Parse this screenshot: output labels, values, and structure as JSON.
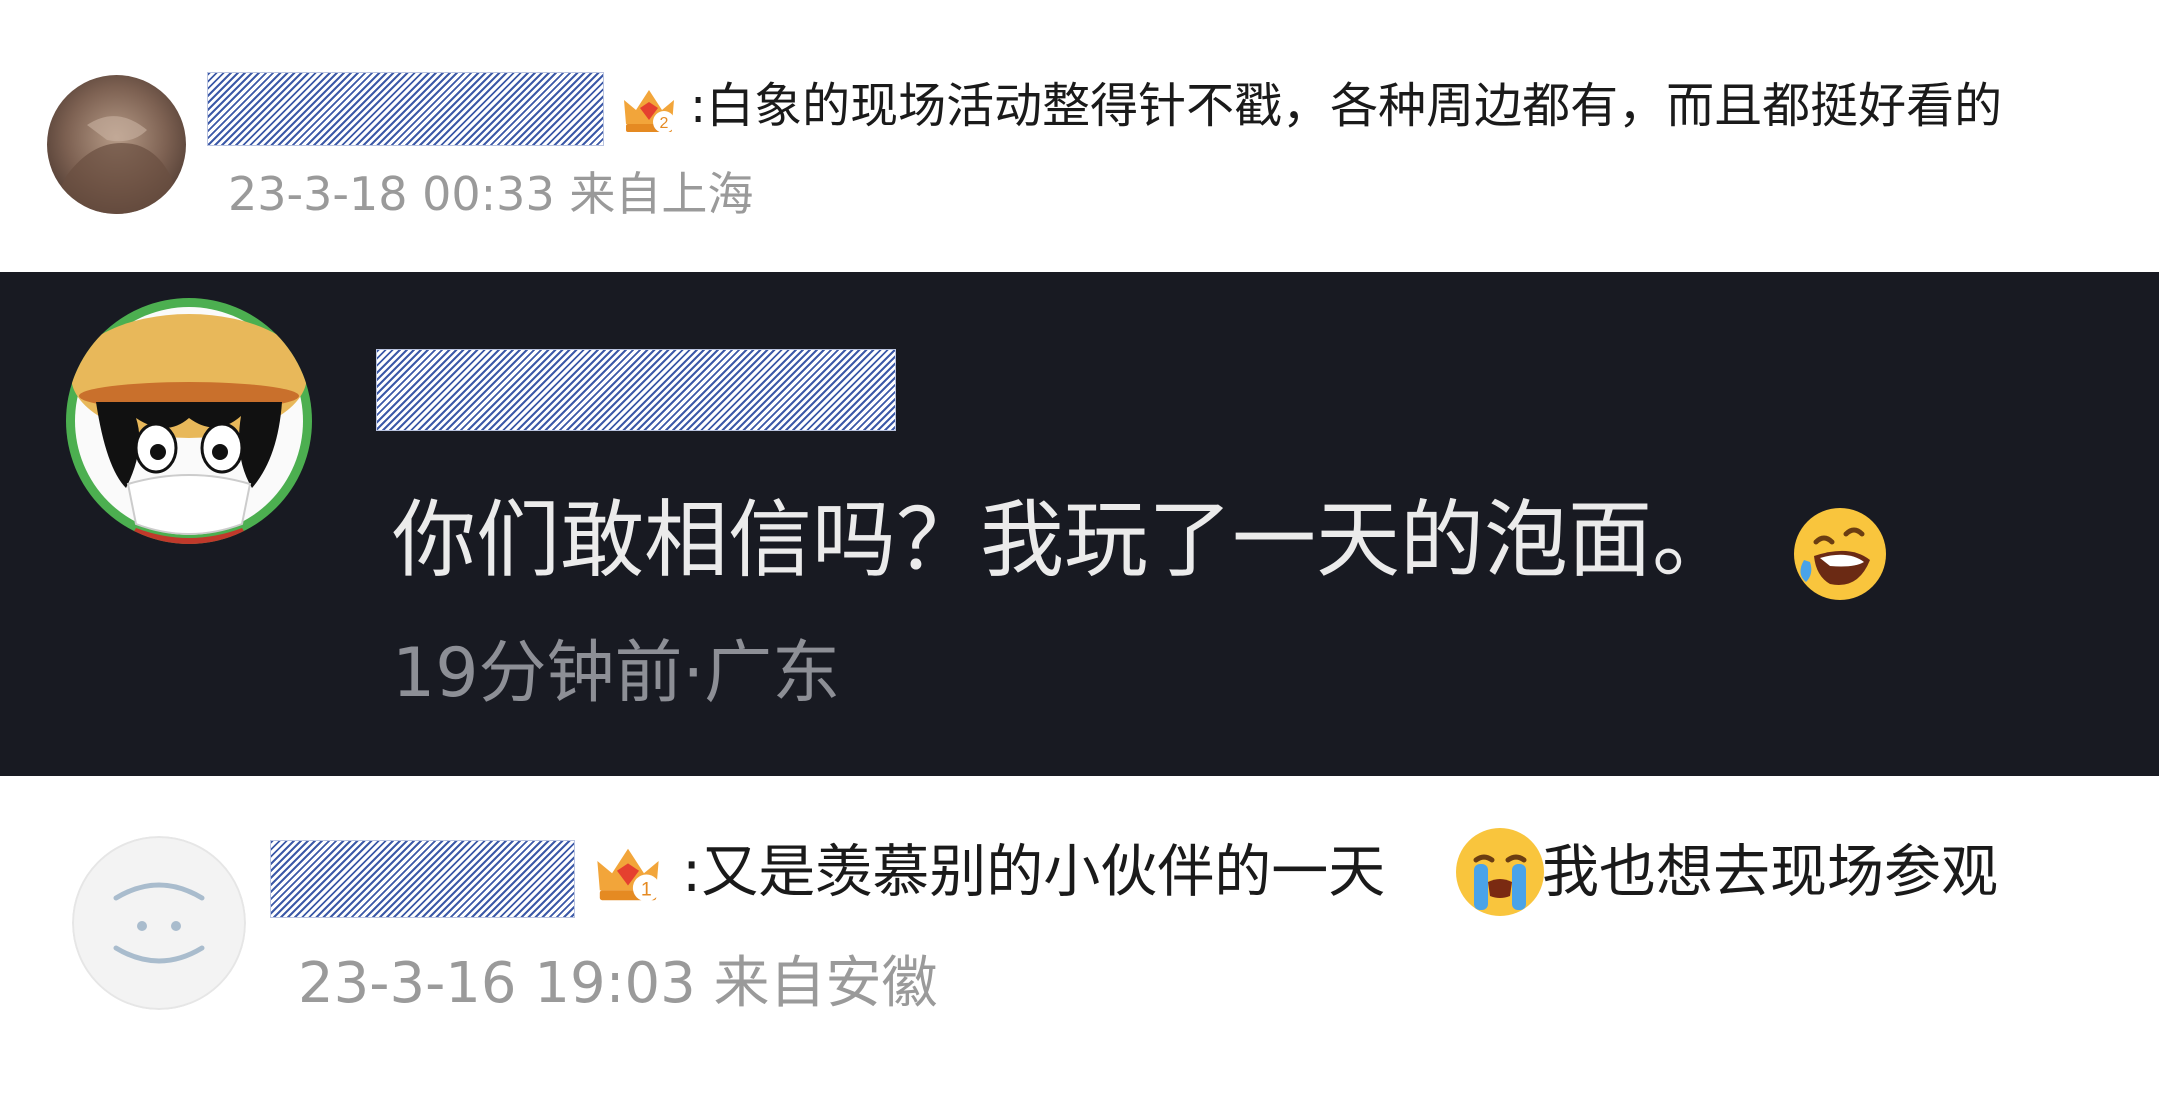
{
  "comments": [
    {
      "text": ":白象的现场活动整得针不戳，各种周边都有，而且都挺好看的",
      "meta": "23-3-18 00:33 来自上海",
      "badge_icon": "crown-gem-badge-icon",
      "badge_level": "2"
    },
    {
      "text": "你们敢相信吗？我玩了一天的泡面。",
      "emoji": "rolling-laughing-emoji-icon",
      "meta": "19分钟前·广东"
    },
    {
      "text": ":又是羡慕别的小伙伴的一天",
      "emoji": "crying-face-emoji-icon",
      "text_after": "我也想去现场参观",
      "meta": "23-3-16 19:03 来自安徽",
      "badge_icon": "crown-gem-badge-icon",
      "badge_level": "1"
    }
  ],
  "colors": {
    "light_bg": "#ffffff",
    "dark_bg": "#181a22",
    "text_dark": "#1a1a1a",
    "text_light": "#ebebeb",
    "meta_gray": "#9a9a9a",
    "redaction_blue": "#3d5aa8"
  }
}
